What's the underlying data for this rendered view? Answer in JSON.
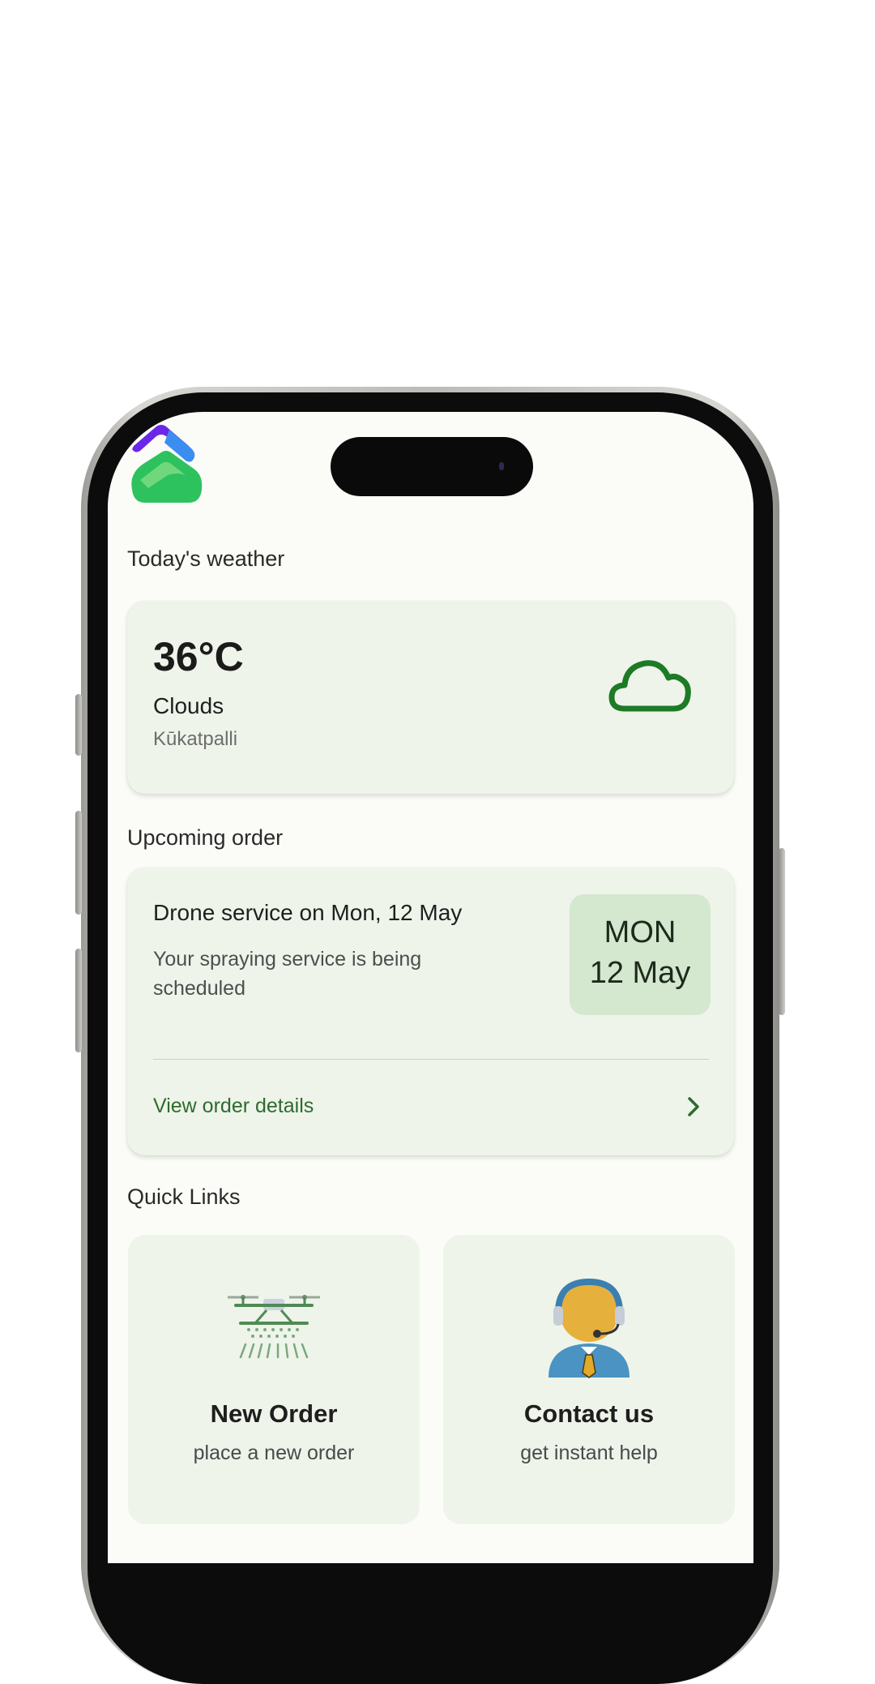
{
  "weather": {
    "section_title": "Today's weather",
    "temperature": "36°C",
    "condition": "Clouds",
    "location": "Kūkatpalli",
    "icon": "cloud-icon"
  },
  "order": {
    "section_title": "Upcoming order",
    "title": "Drone service on Mon, 12 May",
    "description": "Your spraying service is being scheduled",
    "badge_day": "MON",
    "badge_date": "12 May",
    "link_label": "View order details"
  },
  "quick_links": {
    "section_title": "Quick Links",
    "items": [
      {
        "title": "New Order",
        "subtitle": "place a new order",
        "icon": "drone-icon"
      },
      {
        "title": "Contact us",
        "subtitle": "get instant help",
        "icon": "support-agent-icon"
      }
    ]
  },
  "colors": {
    "accent_green": "#2d6b2e",
    "card_bg": "#eef4ea",
    "badge_bg": "#d4e7cf",
    "screen_bg": "#fbfcf7"
  }
}
